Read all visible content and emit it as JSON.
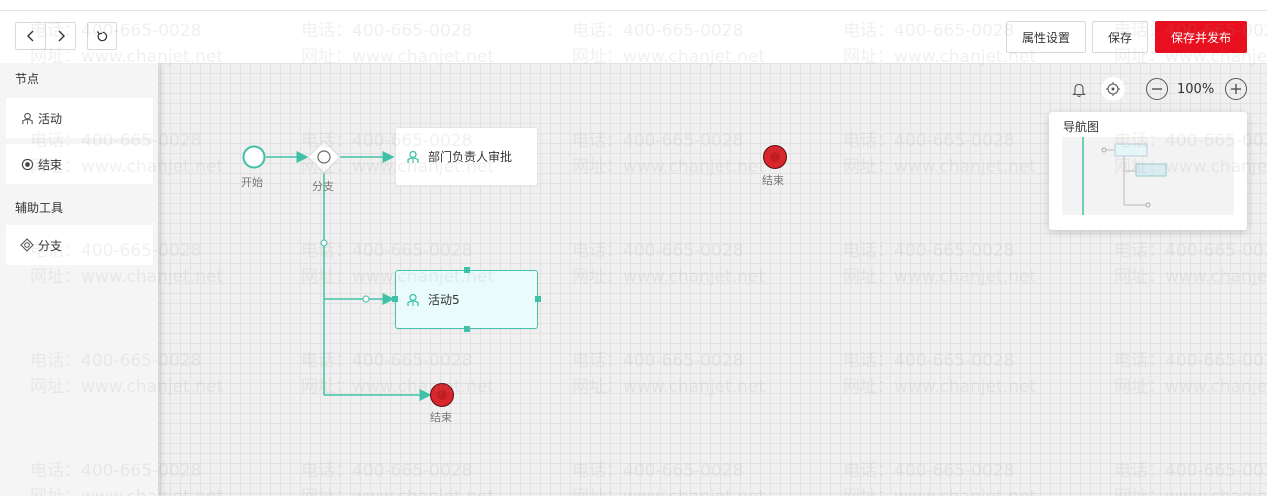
{
  "toolbar": {
    "back_icon": "chevron-left-icon",
    "forward_icon": "chevron-right-icon",
    "refresh_icon": "refresh-icon",
    "properties_label": "属性设置",
    "save_label": "保存",
    "save_publish_label": "保存并发布"
  },
  "sidebar": {
    "nodes_title": "节点",
    "items": [
      {
        "label": "活动",
        "icon": "user-icon"
      },
      {
        "label": "结束",
        "icon": "radio-icon"
      }
    ],
    "tools_title": "辅助工具",
    "tools": [
      {
        "label": "分支",
        "icon": "diamond-icon"
      }
    ]
  },
  "flow": {
    "start_label": "开始",
    "branch_label": "分支",
    "approval_label": "部门负责人审批",
    "activity5_label": "活动5",
    "end_label_top": "结束",
    "end_label_bottom": "结束"
  },
  "zoom": {
    "level": "100%"
  },
  "navmap": {
    "title": "导航图"
  },
  "watermark": {
    "phone": "电话：400-665-0028",
    "site": "网址：www.chanjet.net"
  },
  "colors": {
    "accent": "#3fc1a8",
    "primary": "#e8101f",
    "end_node": "#d7262c"
  }
}
